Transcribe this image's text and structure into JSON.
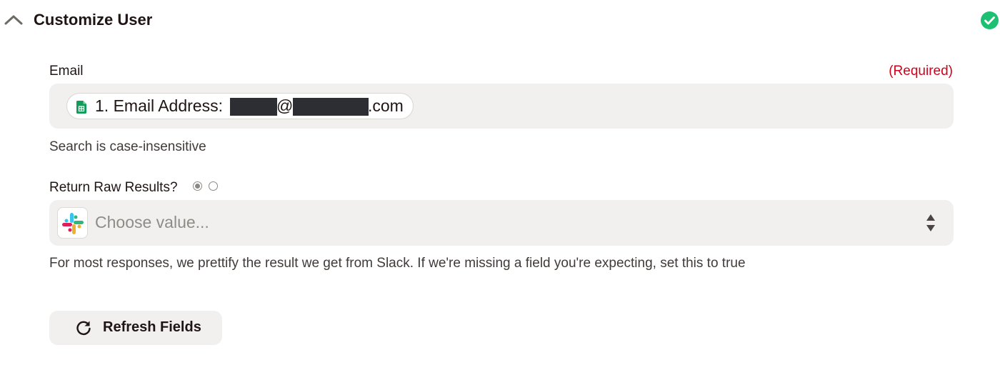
{
  "section": {
    "title": "Customize User",
    "status_color": "#1dbf73"
  },
  "email": {
    "label": "Email",
    "required_text": "(Required)",
    "pill_prefix": "1. Email Address:",
    "pill_at": "@",
    "pill_suffix": ".com",
    "pill_icon": "google-sheets-icon",
    "help": "Search is case-insensitive"
  },
  "raw_results": {
    "label": "Return Raw Results?",
    "radio_options": [
      "on",
      "off"
    ],
    "selected_radio": 0,
    "placeholder": "Choose value...",
    "app_icon": "slack-icon",
    "help": "For most responses, we prettify the result we get from Slack. If we're missing a field you're expecting, set this to true"
  },
  "actions": {
    "refresh_label": "Refresh Fields"
  },
  "colors": {
    "required": "#d0021b",
    "field_bg": "#f1f0ef",
    "text": "#201515"
  }
}
